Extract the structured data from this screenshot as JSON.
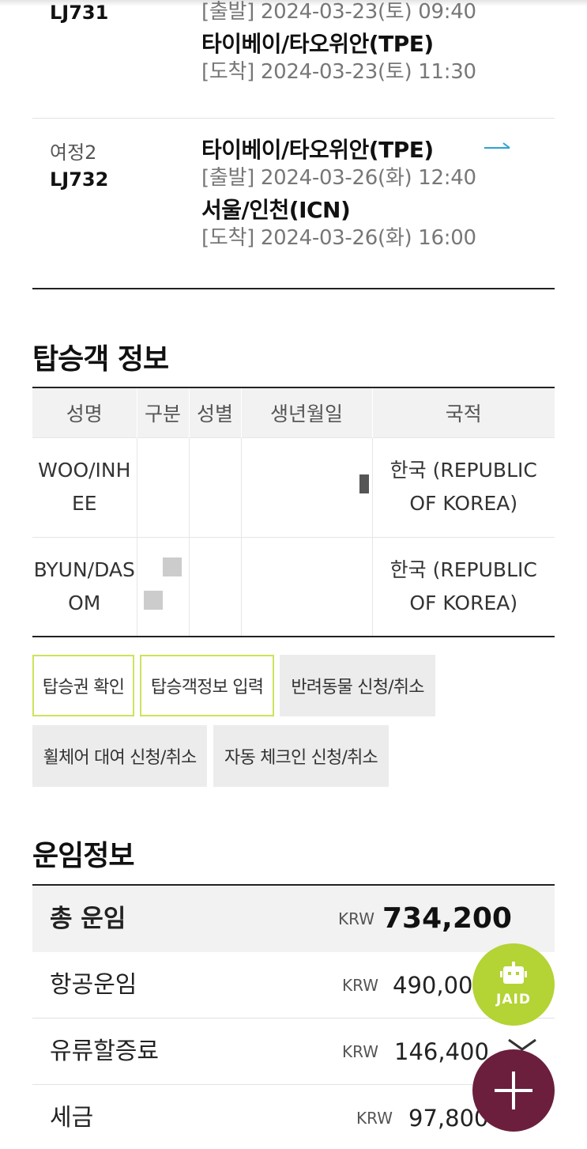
{
  "itinerary": {
    "leg1": {
      "segment": "",
      "flight": "LJ731",
      "depart_label": "[출발] 2024-03-23(토) 09:40",
      "arrival_city": "타이베이/타오위안(TPE)",
      "arrive_label": "[도착] 2024-03-23(토) 11:30"
    },
    "leg2": {
      "segment": "여정2",
      "flight": "LJ732",
      "depart_city": "타이베이/타오위안(TPE)",
      "depart_label": "[출발] 2024-03-26(화) 12:40",
      "arrival_city": "서울/인천(ICN)",
      "arrive_label": "[도착] 2024-03-26(화) 16:00",
      "arrow_icon": "arrow-right-icon",
      "arrow_color": "#2aa3d8"
    }
  },
  "passengers": {
    "title": "탑승객 정보",
    "headers": [
      "성명",
      "구분",
      "성별",
      "생년월일",
      "국적"
    ],
    "rows": [
      {
        "name": "WOO/INHEE",
        "nationality_line1": "한국 (REPUBLIC",
        "nationality_line2": "OF KOREA)"
      },
      {
        "name": "BYUN/DASOM",
        "nationality_line1": "한국 (REPUBLIC",
        "nationality_line2": "OF KOREA)"
      }
    ]
  },
  "actions": {
    "boarding_pass": "탑승권 확인",
    "passenger_info": "탑승객정보 입력",
    "pet": "반려동물 신청/취소",
    "wheelchair": "휠체어 대여 신청/취소",
    "auto_checkin": "자동 체크인 신청/취소",
    "highlight_color": "#cfe25a"
  },
  "fare": {
    "title": "운임정보",
    "total": {
      "label": "총 운임",
      "currency": "KRW",
      "amount": "734,200"
    },
    "items": [
      {
        "label": "항공운임",
        "currency": "KRW",
        "amount": "490,000"
      },
      {
        "label": "유류할증료",
        "currency": "KRW",
        "amount": "146,400"
      },
      {
        "label": "세금",
        "currency": "KRW",
        "amount": "97,800"
      }
    ]
  },
  "fab": {
    "jaid_label": "JAID",
    "jaid_color": "#b4d334",
    "add_color": "#6b1f3d",
    "add_icon": "plus-icon",
    "chevron_icon": "chevron-down-icon"
  }
}
